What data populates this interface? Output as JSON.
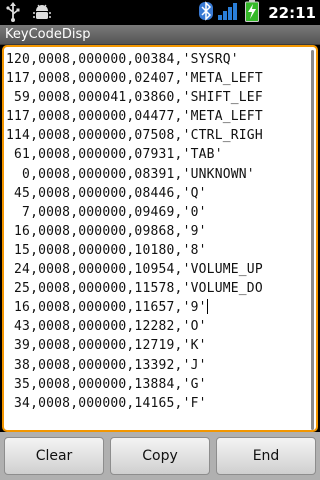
{
  "status_bar": {
    "time": "22:11",
    "icons": [
      "usb-icon",
      "android-debug-icon",
      "bluetooth-icon",
      "signal-icon",
      "battery-charging-icon"
    ],
    "colors": {
      "bluetooth": "#3a7bd5",
      "signal": "#2a7ed8",
      "battery": "#35b829"
    }
  },
  "title_bar": {
    "title": "KeyCodeDisp"
  },
  "log": {
    "lines": [
      "120,0008,000000,00384,'SYSRQ'",
      "117,0008,000000,02407,'META_LEFT",
      " 59,0008,000041,03860,'SHIFT_LEF",
      "117,0008,000000,04477,'META_LEFT",
      "114,0008,000000,07508,'CTRL_RIGH",
      " 61,0008,000000,07931,'TAB'",
      "  0,0008,000000,08391,'UNKNOWN'",
      " 45,0008,000000,08446,'Q'",
      "  7,0008,000000,09469,'0'",
      " 16,0008,000000,09868,'9'",
      " 15,0008,000000,10180,'8'",
      " 24,0008,000000,10954,'VOLUME_UP",
      " 25,0008,000000,11578,'VOLUME_DO",
      " 16,0008,000000,11657,'9'",
      " 43,0008,000000,12282,'O'",
      " 39,0008,000000,12719,'K'",
      " 38,0008,000000,13392,'J'",
      " 35,0008,000000,13884,'G'",
      " 34,0008,000000,14165,'F'"
    ],
    "caret_line": 13,
    "accent_color": "#f29600"
  },
  "buttons": {
    "clear": "Clear",
    "copy": "Copy",
    "end": "End"
  }
}
